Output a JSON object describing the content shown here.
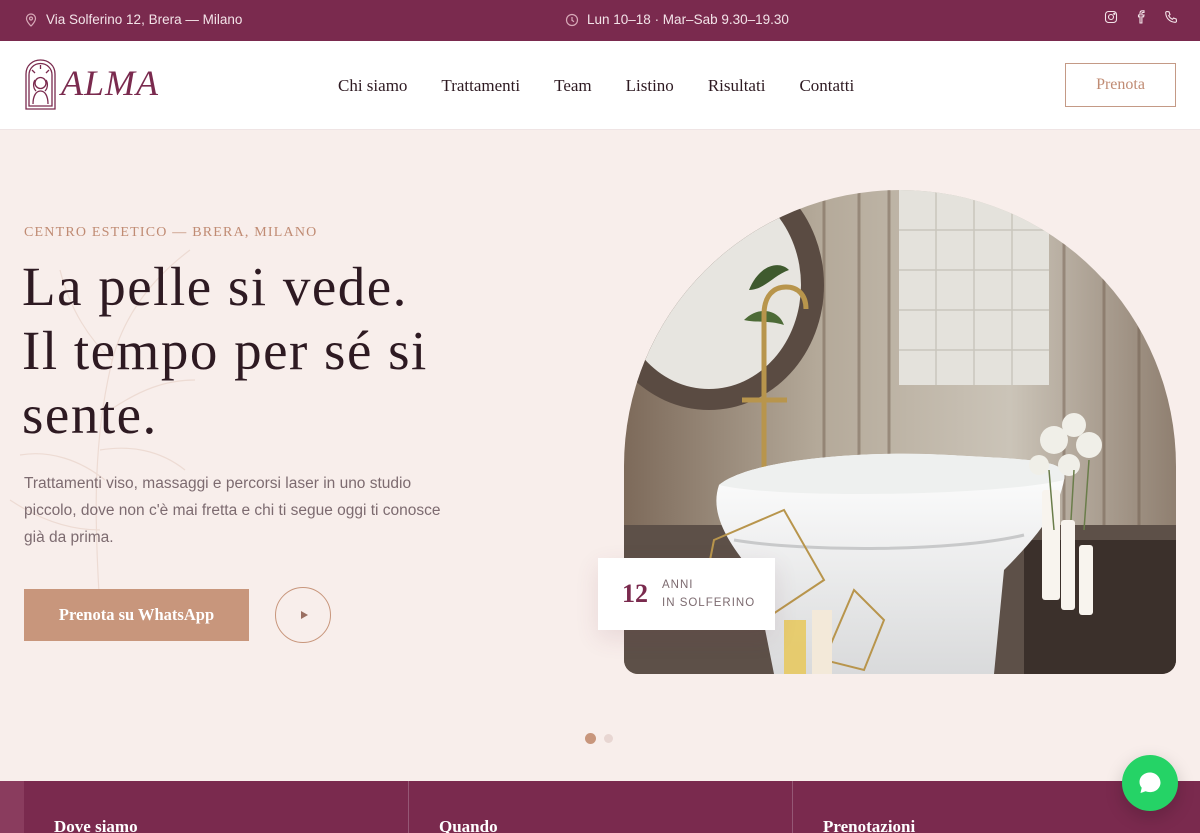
{
  "topbar": {
    "address": "Via Solferino 12, Brera — Milano",
    "hours": "Lun 10–18 · Mar–Sab 9.30–19.30",
    "social": [
      "instagram-icon",
      "facebook-icon",
      "phone-icon"
    ]
  },
  "header": {
    "logo_text": "ALMA",
    "nav": [
      "Chi siamo",
      "Trattamenti",
      "Team",
      "Listino",
      "Risultati",
      "Contatti"
    ],
    "book_label": "Prenota"
  },
  "hero": {
    "eyebrow": "CENTRO ESTETICO — BRERA, MILANO",
    "headline": [
      "La pelle si vede.",
      "Il tempo per sé si",
      "sente."
    ],
    "lead": "Trattamenti viso, massaggi e percorsi laser in uno studio piccolo, dove non c'è mai fretta e chi ti segue oggi ti conosce già da prima.",
    "cta_label": "Prenota su WhatsApp",
    "badge": {
      "number": "12",
      "line1": "ANNI",
      "line2": "IN SOLFERINO"
    },
    "slides": {
      "count": 2,
      "active": 1
    }
  },
  "info": {
    "columns": [
      "Dove siamo",
      "Quando",
      "Prenotazioni"
    ]
  },
  "colors": {
    "brand": "#7a2a4e",
    "accent": "#c8967c",
    "background": "#f8eeeb",
    "whatsapp": "#25d366"
  }
}
